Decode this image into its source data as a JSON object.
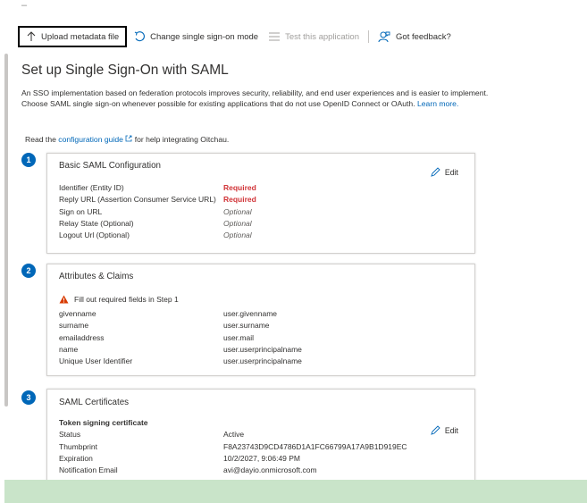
{
  "top_mark": "–",
  "toolbar": {
    "upload_label": "Upload metadata file",
    "change_mode_label": "Change single sign-on mode",
    "test_label": "Test this application",
    "feedback_label": "Got feedback?"
  },
  "page": {
    "title": "Set up Single Sign-On with SAML",
    "description": "An SSO implementation based on federation protocols improves security, reliability, and end user experiences and is easier to implement. Choose SAML single sign-on whenever possible for existing applications that do not use OpenID Connect or OAuth.",
    "learn_more": "Learn more.",
    "guide_prefix": "Read the",
    "guide_link": "configuration guide",
    "guide_suffix": "for help integrating Oitchau."
  },
  "steps": {
    "s1": "1",
    "s2": "2",
    "s3": "3"
  },
  "basic": {
    "title": "Basic SAML Configuration",
    "edit": "Edit",
    "rows": [
      {
        "label": "Identifier (Entity ID)",
        "value": "Required"
      },
      {
        "label": "Reply URL (Assertion Consumer Service URL)",
        "value": "Required"
      },
      {
        "label": "Sign on URL",
        "value": "Optional"
      },
      {
        "label": "Relay State (Optional)",
        "value": "Optional"
      },
      {
        "label": "Logout Url (Optional)",
        "value": "Optional"
      }
    ]
  },
  "attributes": {
    "title": "Attributes & Claims",
    "warning": "Fill out required fields in Step 1",
    "rows": [
      {
        "label": "givenname",
        "value": "user.givenname"
      },
      {
        "label": "surname",
        "value": "user.surname"
      },
      {
        "label": "emailaddress",
        "value": "user.mail"
      },
      {
        "label": "name",
        "value": "user.userprincipalname"
      },
      {
        "label": "Unique User Identifier",
        "value": "user.userprincipalname"
      }
    ]
  },
  "certs": {
    "title": "SAML Certificates",
    "subtitle": "Token signing certificate",
    "edit": "Edit",
    "rows": [
      {
        "label": "Status",
        "value": "Active"
      },
      {
        "label": "Thumbprint",
        "value": "F8A23743D9CD4786D1A1FC66799A17A9B1D919EC"
      },
      {
        "label": "Expiration",
        "value": "10/2/2027, 9:06:49 PM"
      },
      {
        "label": "Notification Email",
        "value": "avi@dayio.onmicrosoft.com"
      }
    ]
  },
  "colors": {
    "accent": "#0067b8",
    "required": "#d13438",
    "warning": "#d83b01",
    "bottom_bar": "#c9e4c9"
  }
}
